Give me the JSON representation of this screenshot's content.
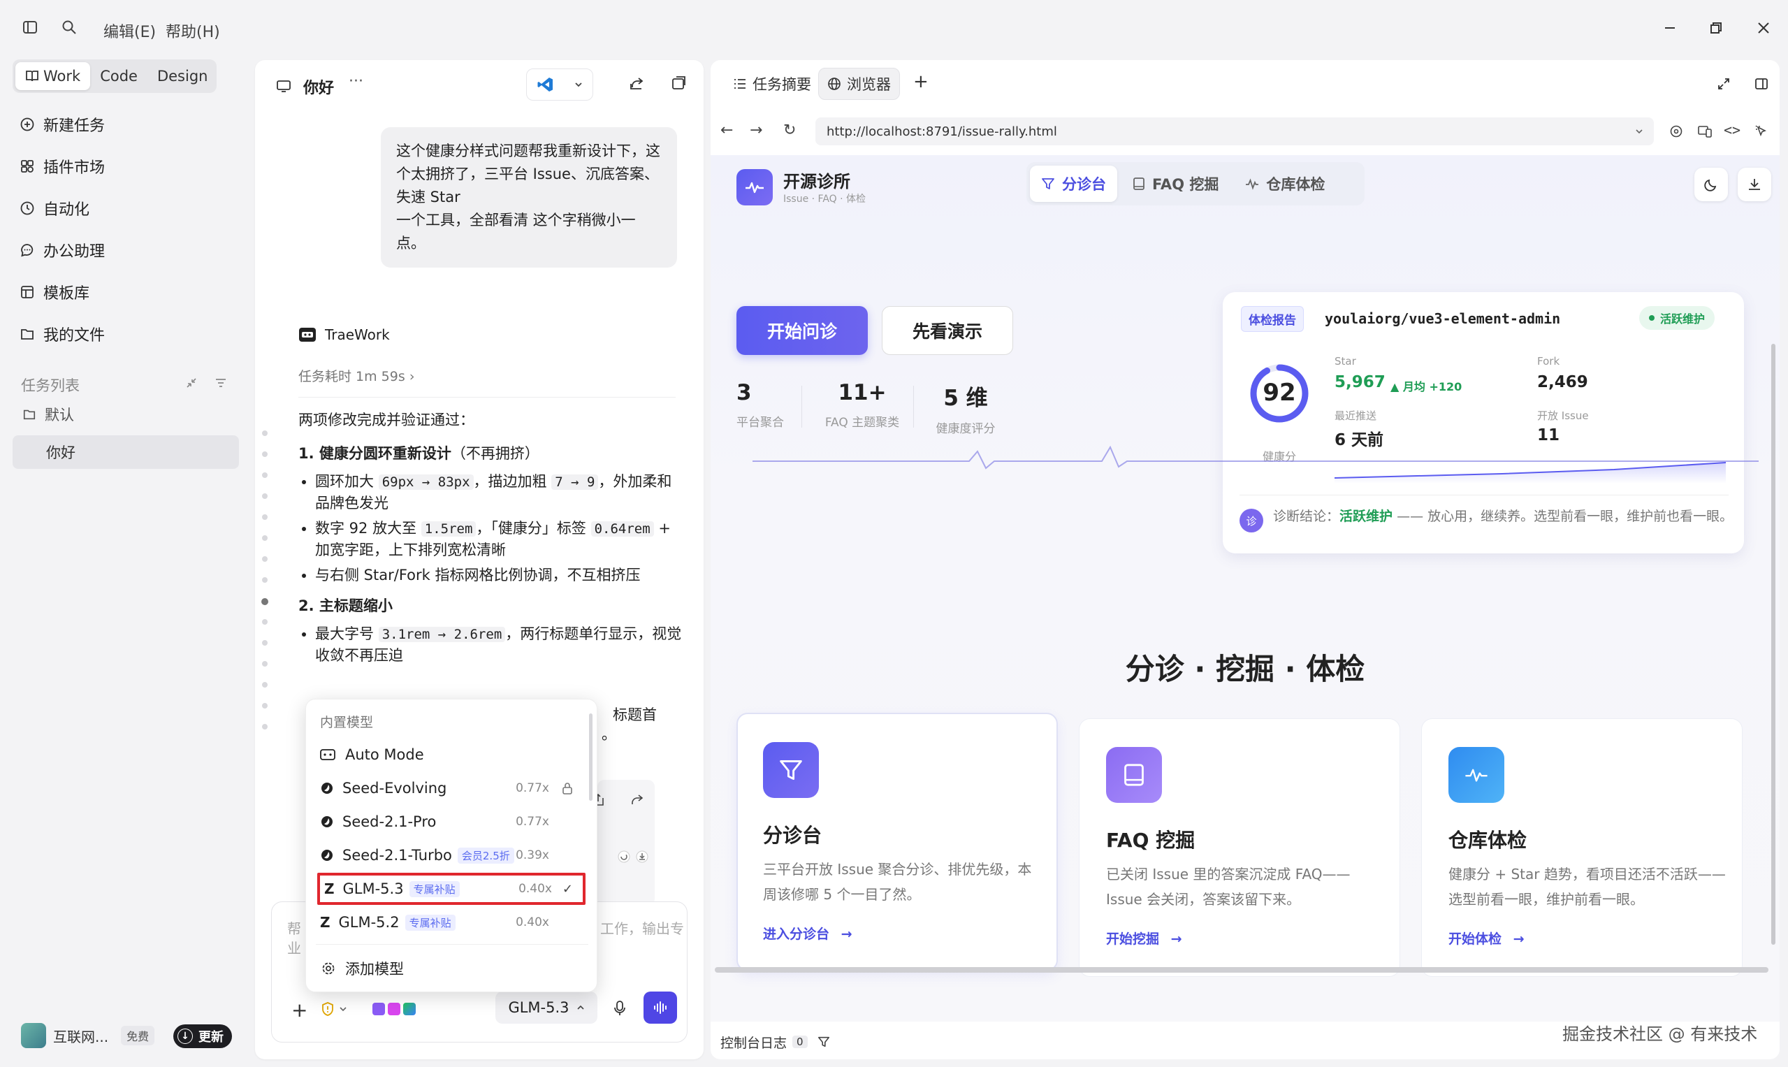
{
  "menu": {
    "edit": "编辑(E)",
    "help": "帮助(H)"
  },
  "modes": [
    "Work",
    "Code",
    "Design"
  ],
  "nav": [
    {
      "icon": "plus-circle-icon",
      "label": "新建任务"
    },
    {
      "icon": "puzzle-icon",
      "label": "插件市场"
    },
    {
      "icon": "clock-icon",
      "label": "自动化"
    },
    {
      "icon": "chat-bubble-icon",
      "label": "办公助理"
    },
    {
      "icon": "template-icon",
      "label": "模板库"
    },
    {
      "icon": "folder-icon",
      "label": "我的文件"
    }
  ],
  "tasks": {
    "header": "任务列表",
    "default_folder": "默认",
    "current": "你好"
  },
  "account": {
    "name": "互联网...",
    "plan": "免费",
    "update": "更新"
  },
  "chat": {
    "title": "你好",
    "user_message": "这个健康分样式问题帮我重新设计下，这个太拥挤了，三平台 Issue、沉底答案、失速 Star\n一个工具，全部看清 这个字稍微小一点。",
    "assistant_name": "TraeWork",
    "duration": "任务耗时 1m 59s",
    "intro": "两项修改完成并验证通过：",
    "s1_title": "1. 健康分圆环重新设计",
    "s1_note": "（不再拥挤）",
    "b1_a": "圆环加大 ",
    "b1_code1": "69px → 83px",
    "b1_b": "，描边加粗 ",
    "b1_code2": "7 → 9",
    "b1_c": "，外加柔和品牌色发光",
    "b2_a": "数字 92 放大至 ",
    "b2_code1": "1.5rem",
    "b2_b": "，「健康分」标签 ",
    "b2_code2": "0.64rem",
    "b2_c": " + 加宽字距，上下排列宽松清晰",
    "b3": "与右侧 Star/Fork 指标网格比例协调，不互相挤压",
    "s2_title": "2. 主标题缩小",
    "b4_a": "最大字号 ",
    "b4_code": "3.1rem → 2.6rem",
    "b4_b": "，两行标题单行显示，视觉收敛不再压迫",
    "trail_a": "标题首",
    "trail_b": "。",
    "composer_placeholder_a": "帮",
    "composer_placeholder_b": "工作，输出专",
    "composer_placeholder_c": "业",
    "model_button": "GLM-5.3"
  },
  "model_menu": {
    "header": "内置模型",
    "items": [
      {
        "name": "Auto Mode",
        "price": "",
        "badge": "",
        "icon": "auto-mode-icon"
      },
      {
        "name": "Seed-Evolving",
        "price": "0.77x",
        "badge": "",
        "icon": "seed-icon",
        "locked": true
      },
      {
        "name": "Seed-2.1-Pro",
        "price": "0.77x",
        "badge": "",
        "icon": "seed-icon"
      },
      {
        "name": "Seed-2.1-Turbo",
        "price": "0.39x",
        "badge": "会员2.5折",
        "icon": "seed-icon"
      },
      {
        "name": "GLM-5.3",
        "price": "0.40x",
        "badge": "专属补贴",
        "icon": "glm-icon",
        "selected": true
      },
      {
        "name": "GLM-5.2",
        "price": "0.40x",
        "badge": "专属补贴",
        "icon": "glm-icon"
      }
    ],
    "add": "添加模型"
  },
  "browser": {
    "tab_summary": "任务摘要",
    "tab_browser": "浏览器",
    "url": "http://localhost:8791/issue-rally.html",
    "console_label": "控制台日志",
    "console_count": "0"
  },
  "site": {
    "brand": "开源诊所",
    "brand_sub": "Issue · FAQ · 体检",
    "seg": [
      "分诊台",
      "FAQ 挖掘",
      "仓库体检"
    ],
    "btn_start": "开始问诊",
    "btn_demo": "先看演示",
    "stats": [
      {
        "num": "3",
        "label": "平台聚合"
      },
      {
        "num": "11+",
        "label": "FAQ 主题聚类"
      },
      {
        "num": "5 维",
        "label": "健康度评分"
      }
    ],
    "report": {
      "tag": "体检报告",
      "repo": "youlaiorg/vue3-element-admin",
      "status": "活跃维护",
      "score": "92",
      "score_label": "健康分",
      "star_label": "Star",
      "star_value": "5,967",
      "star_delta": "▲ 月均 +120",
      "fork_label": "Fork",
      "fork_value": "2,469",
      "push_label": "最近推送",
      "push_value": "6 天前",
      "issue_label": "开放 Issue",
      "issue_value": "11",
      "diag_badge": "诊",
      "diag_prefix": "诊断结论：",
      "diag_status": "活跃维护",
      "diag_text": " —— 放心用，继续养。选型前看一眼，维护前也看一眼。"
    },
    "section_title": "分诊 · 挖掘 · 体检",
    "features": [
      {
        "title": "分诊台",
        "desc": "三平台开放 Issue 聚合分诊、排优先级，本周该修哪 5 个一目了然。",
        "link": "进入分诊台"
      },
      {
        "title": "FAQ 挖掘",
        "desc": "已关闭 Issue 里的答案沉淀成 FAQ——Issue 会关闭，答案该留下来。",
        "link": "开始挖掘"
      },
      {
        "title": "仓库体检",
        "desc": "健康分 + Star 趋势，看项目还活不活跃——选型前看一眼，维护前看一眼。",
        "link": "开始体检"
      }
    ]
  },
  "watermark": "掘金技术社区 @ 有来技术",
  "colors": {
    "accent": "#5b5cf0",
    "green": "#1f9d55",
    "highlight_red": "#e0272e"
  }
}
